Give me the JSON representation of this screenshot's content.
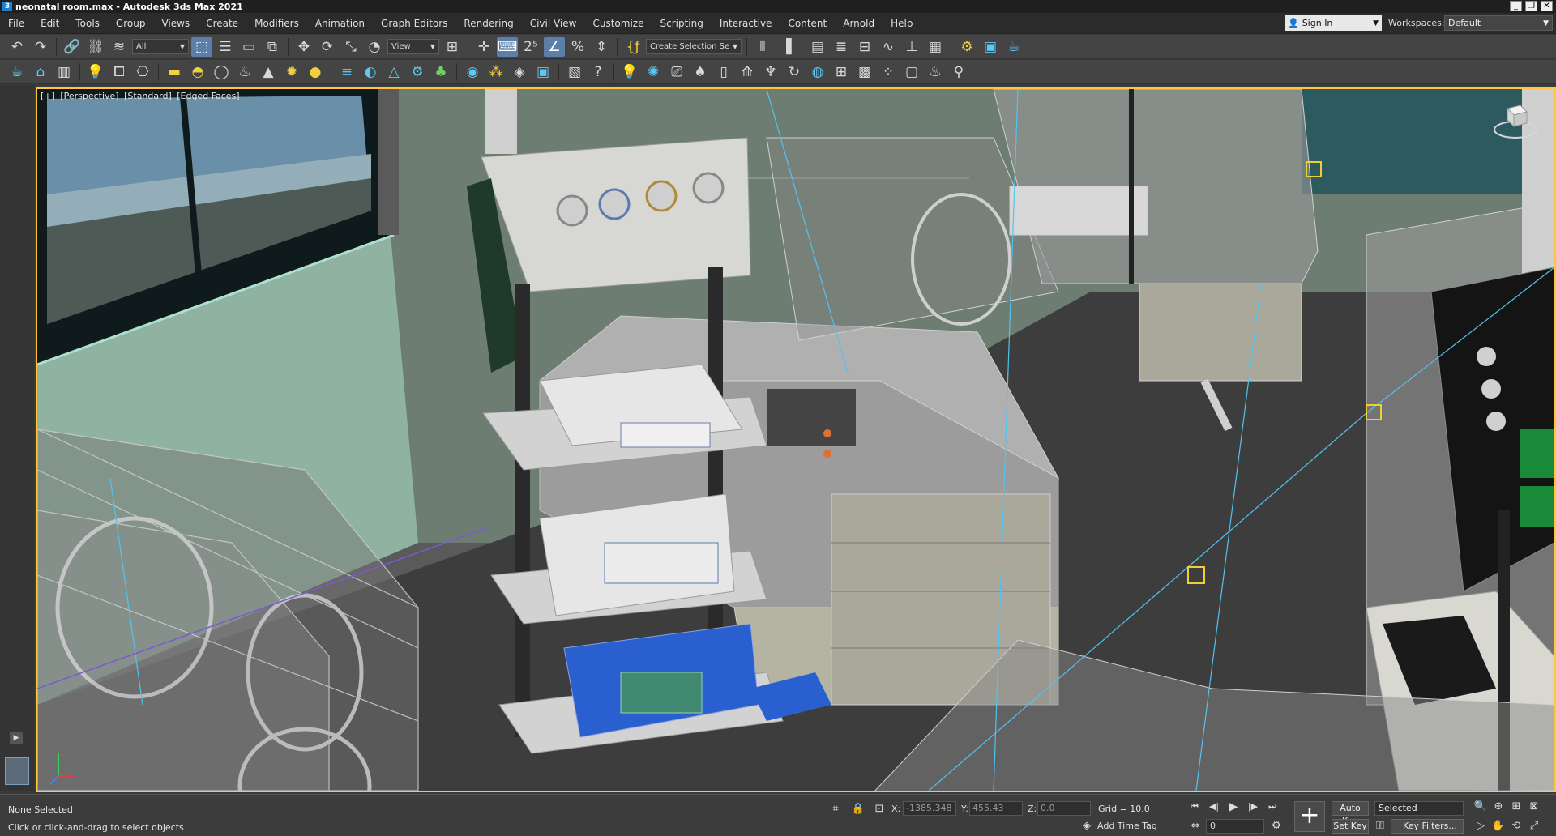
{
  "window": {
    "title": "neonatal room.max - Autodesk 3ds Max 2021",
    "app_icon": "3",
    "controls": [
      "_",
      "❐",
      "✕"
    ]
  },
  "menu": {
    "items": [
      "File",
      "Edit",
      "Tools",
      "Group",
      "Views",
      "Create",
      "Modifiers",
      "Animation",
      "Graph Editors",
      "Rendering",
      "Civil View",
      "Customize",
      "Scripting",
      "Interactive",
      "Content",
      "Arnold",
      "Help"
    ],
    "sign_in": "Sign In",
    "workspaces_label": "Workspaces:",
    "workspace_value": "Default"
  },
  "toolbar_main": {
    "selection_filter": "All",
    "reference_coord": "View",
    "named_selection": "Create Selection Se",
    "icons": [
      "undo-icon",
      "redo-icon",
      "link-icon",
      "unlink-icon",
      "bind-space-warp-icon",
      "select-object-icon",
      "select-by-name-icon",
      "rect-selection-icon",
      "window-crossing-icon",
      "move-icon",
      "rotate-icon",
      "scale-icon",
      "placement-icon",
      "use-pivot-icon",
      "select-manipulate-icon",
      "keyboard-shortcut-icon",
      "snaps-toggle-icon",
      "angle-snap-icon",
      "percent-snap-icon",
      "spinner-snap-icon",
      "edit-named-selection-icon",
      "mirror-icon",
      "align-icon",
      "scene-explorer-icon",
      "layer-explorer-icon",
      "toggle-ribbon-icon",
      "curve-editor-icon",
      "schematic-view-icon",
      "material-editor-icon",
      "render-setup-icon",
      "rendered-frame-icon",
      "render-production-icon",
      "render-shade-icon"
    ]
  },
  "toolbar_second": {
    "icons": [
      "teapot-icon",
      "viewport-icon",
      "frame-icon",
      "light-icon",
      "camera-group-icon",
      "camera-icon",
      "box-icon",
      "dome-icon",
      "sphere-icon",
      "teapot-small-icon",
      "cone-icon",
      "sun-icon",
      "sphere-yellow-icon",
      "hair-icon",
      "wave-icon",
      "pyramid-icon",
      "gear-icon",
      "plant-icon",
      "globe-icon",
      "particles-icon",
      "material-icon",
      "render-icon",
      "bitmap-icon",
      "help-icon",
      "light-bulb-icon",
      "omni-light-icon",
      "spot-camera-icon",
      "tree-icon",
      "book-icon",
      "pine-icon",
      "cactus-icon",
      "reload-icon",
      "sky-icon",
      "grid-icon",
      "display-icon",
      "network-icon",
      "frame2-icon",
      "teapot2-icon",
      "bulb-icon"
    ]
  },
  "viewport": {
    "labels": [
      "[+]",
      "[Perspective]",
      "[Standard]",
      "[Edged Faces]"
    ]
  },
  "status": {
    "selection": "None Selected",
    "prompt": "Click or click-and-drag to select objects",
    "x_label": "X:",
    "x_value": "-1385.348",
    "y_label": "Y:",
    "y_value": "455.43",
    "z_label": "Z:",
    "z_value": "0.0",
    "grid": "Grid = 10.0",
    "add_time_tag": "Add Time Tag",
    "frame": "0",
    "auto_key": "Auto Key",
    "set_key": "Set Key",
    "key_mode": "Selected",
    "key_filters": "Key Filters..."
  }
}
